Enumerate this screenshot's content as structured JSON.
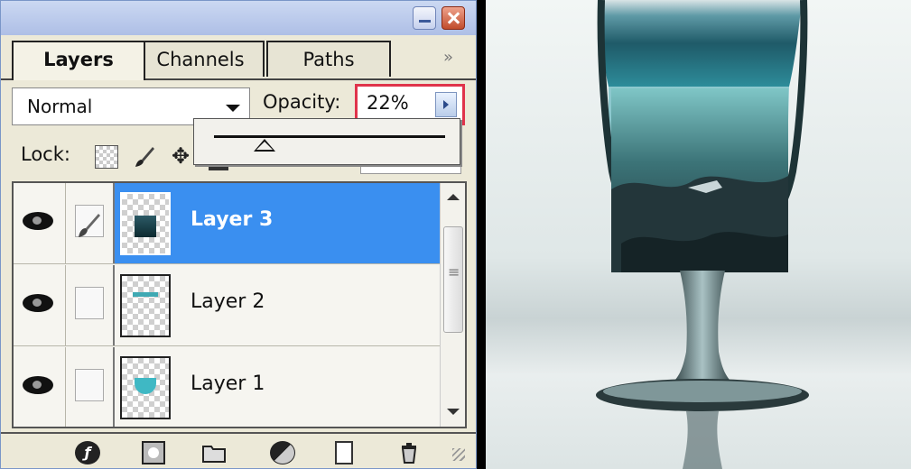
{
  "window": {
    "minimize_icon": "minimize-icon",
    "close_icon": "close-icon"
  },
  "tabs": [
    {
      "label": "Layers",
      "active": true
    },
    {
      "label": "Channels",
      "active": false
    },
    {
      "label": "Paths",
      "active": false
    }
  ],
  "more_label": "»",
  "blend_mode": "Normal",
  "opacity": {
    "label": "Opacity:",
    "value": "22%",
    "slider_fraction": 0.22,
    "highlight_color": "#e0334b"
  },
  "lock": {
    "label": "Lock:",
    "icons": [
      "lock-transparent-icon",
      "lock-brush-icon",
      "lock-move-icon",
      "lock-all-icon"
    ]
  },
  "layers": [
    {
      "name": "Layer 3",
      "visible": true,
      "selected": true,
      "linked_brush": true
    },
    {
      "name": "Layer 2",
      "visible": true,
      "selected": false,
      "linked_brush": false
    },
    {
      "name": "Layer 1",
      "visible": true,
      "selected": false,
      "linked_brush": false
    }
  ],
  "bottom_toolbar": [
    "layer-style-icon",
    "layer-mask-icon",
    "new-group-icon",
    "adjustment-layer-icon",
    "new-layer-icon",
    "trash-icon"
  ],
  "colors": {
    "selection": "#3a8ff0",
    "panel_bg": "#ece9d8",
    "water": "#2f6f7c"
  }
}
